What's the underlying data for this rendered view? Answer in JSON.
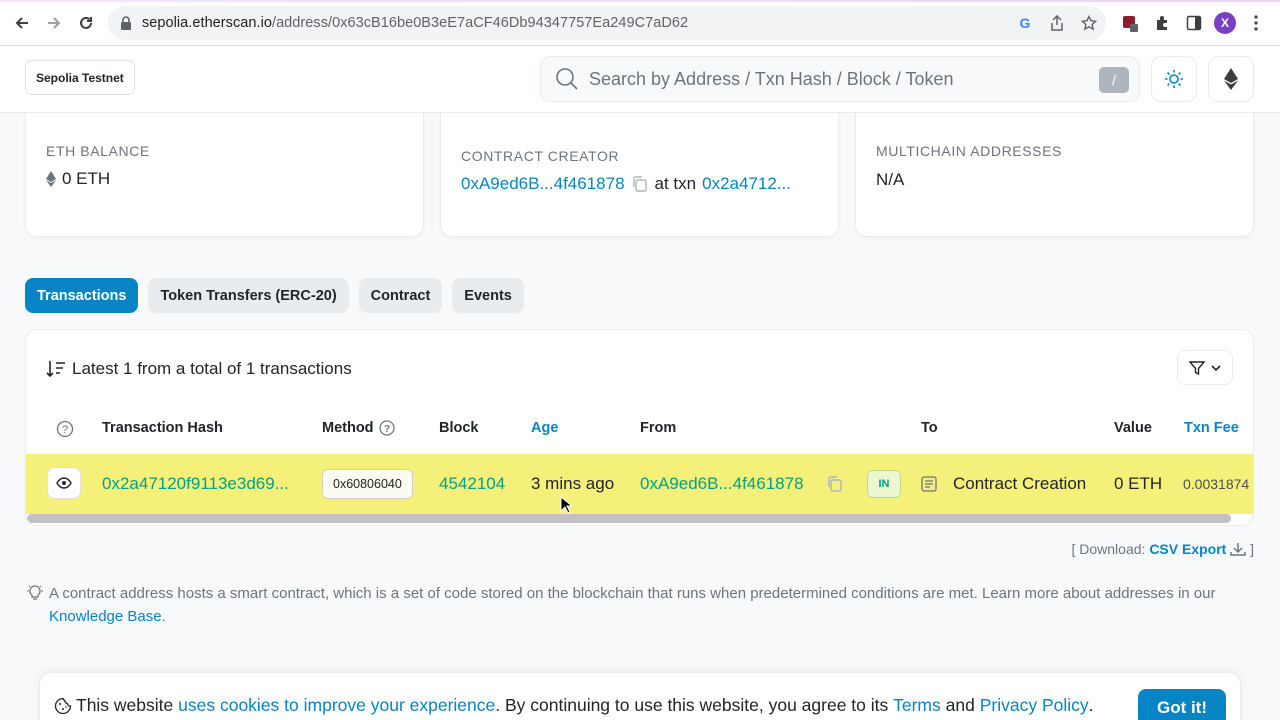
{
  "browser": {
    "url_host": "sepolia.etherscan.io",
    "url_path": "/address/0x63cB16be0B3eE7aCF46Db94347757Ea249C7aD62",
    "avatar_letter": "X"
  },
  "header": {
    "network": "Sepolia Testnet",
    "search_placeholder": "Search by Address / Txn Hash / Block / Token",
    "search_shortcut": "/"
  },
  "overview": {
    "balance": {
      "label": "ETH BALANCE",
      "value": "0 ETH"
    },
    "creator": {
      "label": "CONTRACT CREATOR",
      "address": "0xA9ed6B...4f461878",
      "at_txn": "at txn",
      "txn": "0x2a4712..."
    },
    "multichain": {
      "label": "MULTICHAIN ADDRESSES",
      "value": "N/A"
    }
  },
  "tabs": [
    {
      "label": "Transactions",
      "active": true
    },
    {
      "label": "Token Transfers (ERC-20)",
      "active": false
    },
    {
      "label": "Contract",
      "active": false
    },
    {
      "label": "Events",
      "active": false
    }
  ],
  "transactions": {
    "summary": "Latest 1 from a total of 1 transactions",
    "columns": {
      "hash": "Transaction Hash",
      "method": "Method",
      "block": "Block",
      "age": "Age",
      "from": "From",
      "to": "To",
      "value": "Value",
      "fee": "Txn Fee"
    },
    "rows": [
      {
        "hash": "0x2a47120f9113e3d69...",
        "method": "0x60806040",
        "block": "4542104",
        "age": "3 mins ago",
        "from": "0xA9ed6B...4f461878",
        "direction": "IN",
        "to": "Contract Creation",
        "value": "0 ETH",
        "fee": "0.0031874"
      }
    ]
  },
  "download": {
    "prefix": "[ Download:",
    "link": "CSV Export",
    "suffix": "]"
  },
  "info": {
    "text": "A contract address hosts a smart contract, which is a set of code stored on the blockchain that runs when predetermined conditions are met. Learn more about addresses in our",
    "link": "Knowledge Base",
    "end": "."
  },
  "cookie": {
    "part1": "This website",
    "link1": "uses cookies to improve your experience",
    "part2": ". By continuing to use this website, you agree to its",
    "link2": "Terms",
    "part3": "and",
    "link3": "Privacy Policy",
    "part4": ".",
    "button": "Got it!"
  },
  "colors": {
    "accent": "#0784c3",
    "highlight_row": "#f5f07a",
    "green": "#00a186"
  }
}
